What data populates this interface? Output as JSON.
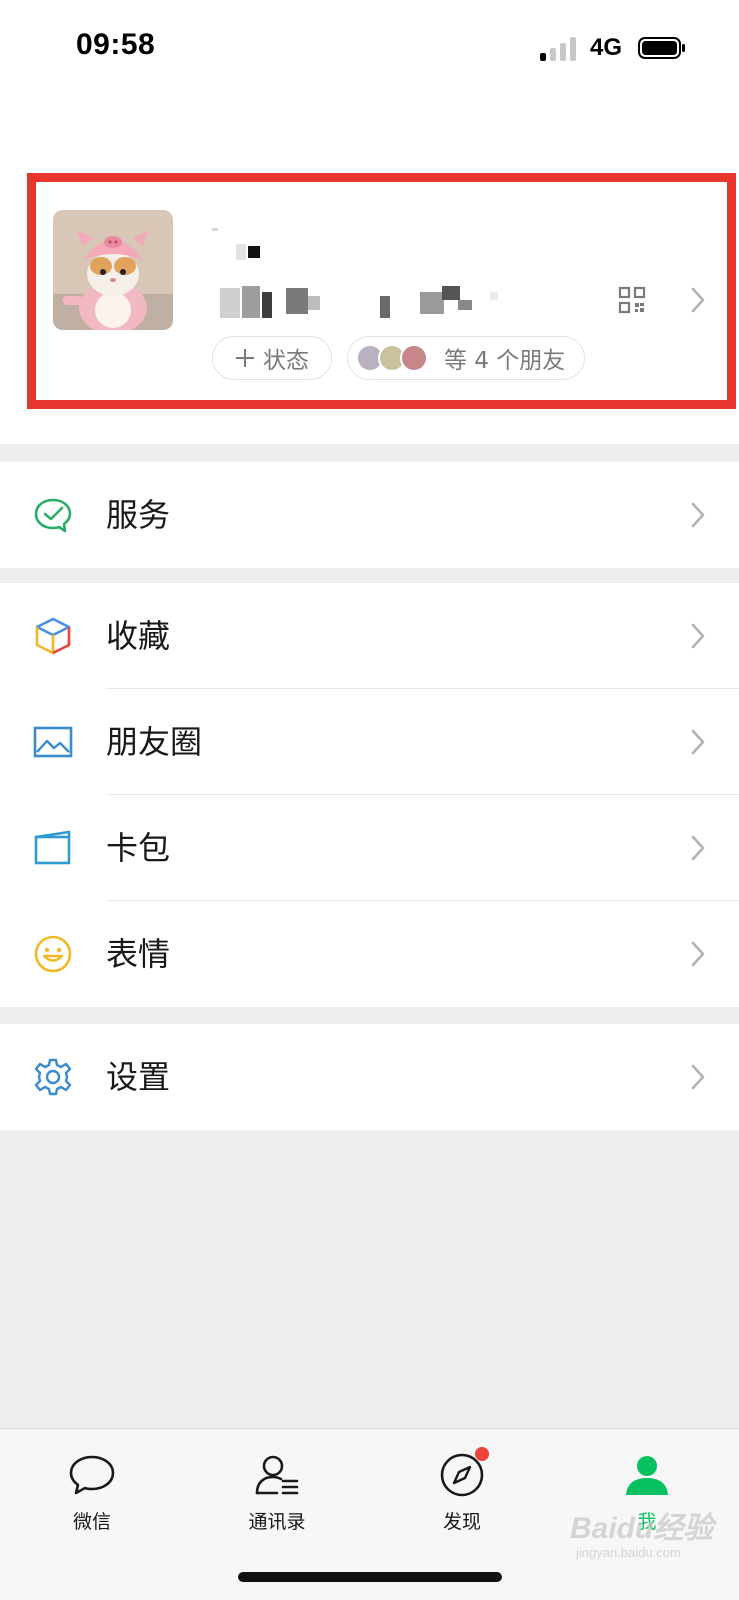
{
  "status_bar": {
    "time": "09:58",
    "network": "4G"
  },
  "profile": {
    "status_button_label": "状态",
    "friends_label": "等 4 个朋友"
  },
  "menu": {
    "services": "服务",
    "favorites": "收藏",
    "moments": "朋友圈",
    "cards": "卡包",
    "stickers": "表情",
    "settings": "设置"
  },
  "tab_bar": {
    "tabs": [
      {
        "label": "微信",
        "icon": "chat-bubble-icon"
      },
      {
        "label": "通讯录",
        "icon": "contacts-icon"
      },
      {
        "label": "发现",
        "icon": "compass-icon"
      },
      {
        "label": "我",
        "icon": "person-icon",
        "active": true
      }
    ]
  },
  "watermark": {
    "brand": "Baidu经验",
    "domain": "jingyan.baidu.com"
  },
  "colors": {
    "accent_green": "#07c160",
    "highlight_red": "#e8362f",
    "badge_red": "#f0413b"
  }
}
